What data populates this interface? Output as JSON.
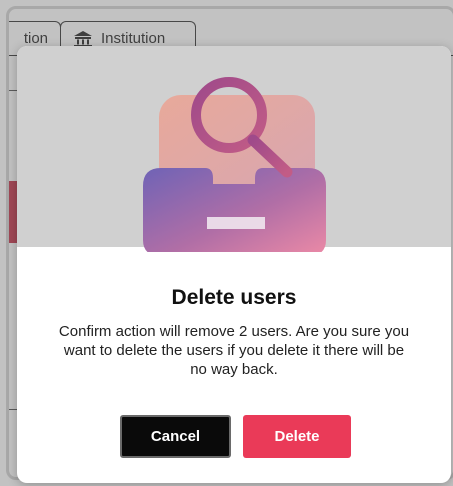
{
  "background": {
    "tabs": [
      {
        "label": "tion",
        "icon": "generic-tab-icon"
      },
      {
        "label": "Institution",
        "icon": "institution-icon"
      }
    ]
  },
  "modal": {
    "illustration": "inbox-search-illustration",
    "title": "Delete users",
    "message": "Confirm action will remove 2 users. Are you sure you want to delete the users if you delete it there will be no way back.",
    "cancel_label": "Cancel",
    "delete_label": "Delete"
  },
  "colors": {
    "overlay": "#8a8a8a",
    "hero_bg": "#d0d0d0",
    "delete_accent": "#ea3a58",
    "cancel_bg": "#0a0a0a"
  }
}
